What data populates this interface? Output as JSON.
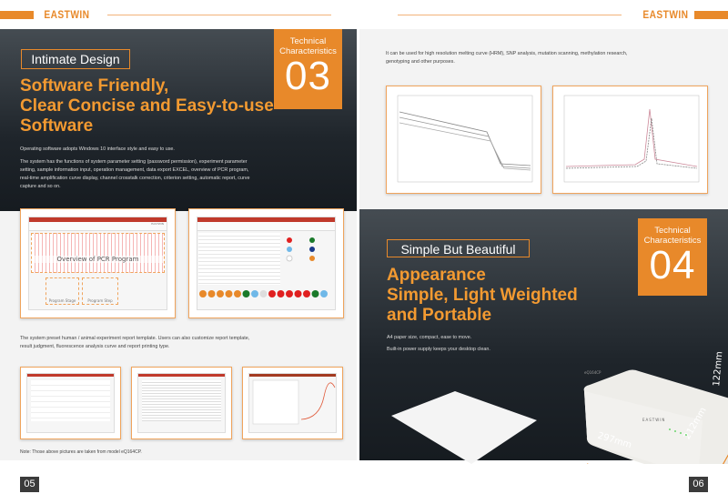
{
  "header": {
    "brand_left": "EASTWIN",
    "brand_right": "EASTWIN"
  },
  "left_page": {
    "tag": "Intimate Design",
    "badge": {
      "label": "Technical Characteristics",
      "number": "03"
    },
    "headline": [
      "Software Friendly,",
      "Clear Concise and Easy-to-use",
      "Software"
    ],
    "para1": "Operating software adopts Windows 10 interface style and easy to use.",
    "para2": "The system has the functions of system parameter setting (password permission), experiment parameter setting, sample information input, operation management, data export EXCEL, overview of PCR program, real-time amplification curve display, channel crosstalk correction, criterion setting, automatic report, curve capture and so on.",
    "screenshot1": {
      "overlay": "Overview of PCR Program",
      "stage": "Program Stage",
      "step": "Program Step",
      "logo": "EASTWIN"
    },
    "para3": "The system preset human / animal experiment report template. Users can also customize report template, result judgment, fluorescence analysis curve and report printing type.",
    "note": "Note: Those above pictures are taken from model eQ164CP.",
    "page_number": "05"
  },
  "right_page": {
    "intro": "It can be used for high resolution melting curve (HRM), SNP analysis, mutation scanning, methylation research, genotyping and other purposes.",
    "tag": "Simple But Beautiful",
    "badge": {
      "label": "Technical Characteristics",
      "number": "04"
    },
    "headline": [
      "Appearance",
      "Simple, Light Weighted",
      "and Portable"
    ],
    "para1": "A4 paper size, compact, ease to move.",
    "para2": "Built-in power supply keeps your desktop clean.",
    "device": {
      "model": "eQ164CP",
      "logo": "EASTWIN",
      "width": "297mm",
      "depth": "212mm",
      "height": "122mm"
    },
    "page_number": "06"
  },
  "colors": {
    "accent": "#e8892a",
    "dark": "#1f252b",
    "light": "#f3f3f3"
  }
}
